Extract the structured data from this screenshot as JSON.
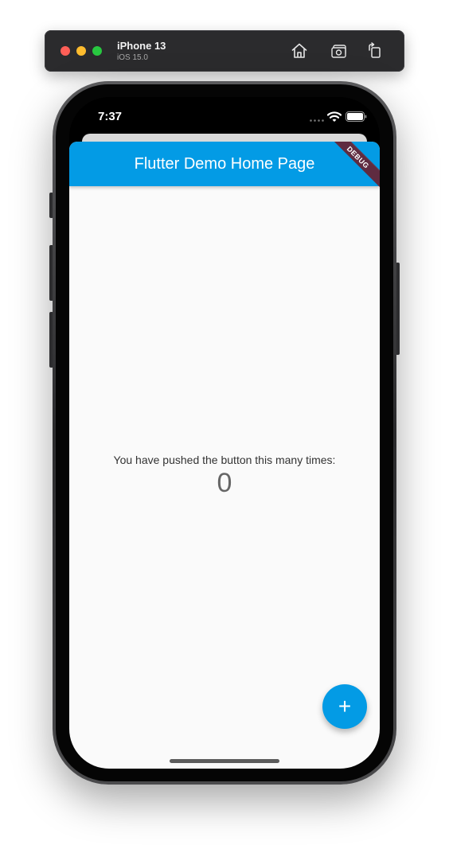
{
  "simulator": {
    "device_name": "iPhone 13",
    "os_version": "iOS 15.0",
    "buttons": {
      "home_icon": "home-icon",
      "screenshot_icon": "camera-icon",
      "rotate_icon": "rotate-icon"
    }
  },
  "status_bar": {
    "time": "7:37",
    "signal_icon": "signal-dots-icon",
    "wifi_icon": "wifi-icon",
    "battery_icon": "battery-icon"
  },
  "app": {
    "title": "Flutter Demo Home Page",
    "debug_banner": "DEBUG",
    "counter_label": "You have pushed the button this many times:",
    "counter_value": "0",
    "fab_label": "+",
    "fab_icon": "plus-icon"
  },
  "colors": {
    "app_bar": "#039be5",
    "fab": "#039be5",
    "background": "#fafafa",
    "debug_banner": "#840000"
  }
}
